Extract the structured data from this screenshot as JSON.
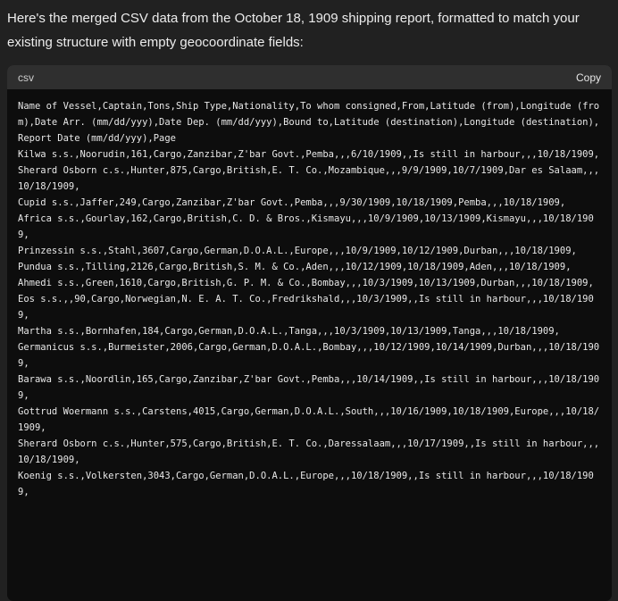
{
  "message": {
    "intro_text": "Here's the merged CSV data from the October 18, 1909 shipping report, formatted to match your existing structure with empty geocoordinate fields:"
  },
  "code_block": {
    "language": "csv",
    "copy_label": "Copy",
    "content": "Name of Vessel,Captain,Tons,Ship Type,Nationality,To whom consigned,From,Latitude (from),Longitude (from),Date Arr. (mm/dd/yyy),Date Dep. (mm/dd/yyy),Bound to,Latitude (destination),Longitude (destination),Report Date (mm/dd/yyy),Page\nKilwa s.s.,Noorudin,161,Cargo,Zanzibar,Z'bar Govt.,Pemba,,,6/10/1909,,Is still in harbour,,,10/18/1909,\nSherard Osborn c.s.,Hunter,875,Cargo,British,E. T. Co.,Mozambique,,,9/9/1909,10/7/1909,Dar es Salaam,,,10/18/1909,\nCupid s.s.,Jaffer,249,Cargo,Zanzibar,Z'bar Govt.,Pemba,,,9/30/1909,10/18/1909,Pemba,,,10/18/1909,\nAfrica s.s.,Gourlay,162,Cargo,British,C. D. & Bros.,Kismayu,,,10/9/1909,10/13/1909,Kismayu,,,10/18/1909,\nPrinzessin s.s.,Stahl,3607,Cargo,German,D.O.A.L.,Europe,,,10/9/1909,10/12/1909,Durban,,,10/18/1909,\nPundua s.s.,Tilling,2126,Cargo,British,S. M. & Co.,Aden,,,10/12/1909,10/18/1909,Aden,,,10/18/1909,\nAhmedi s.s.,Green,1610,Cargo,British,G. P. M. & Co.,Bombay,,,10/3/1909,10/13/1909,Durban,,,10/18/1909,\nEos s.s.,,90,Cargo,Norwegian,N. E. A. T. Co.,Fredrikshald,,,10/3/1909,,Is still in harbour,,,10/18/1909,\nMartha s.s.,Bornhafen,184,Cargo,German,D.O.A.L.,Tanga,,,10/3/1909,10/13/1909,Tanga,,,10/18/1909,\nGermanicus s.s.,Burmeister,2006,Cargo,German,D.O.A.L.,Bombay,,,10/12/1909,10/14/1909,Durban,,,10/18/1909,\nBarawa s.s.,Noordlin,165,Cargo,Zanzibar,Z'bar Govt.,Pemba,,,10/14/1909,,Is still in harbour,,,10/18/1909,\nGottrud Woermann s.s.,Carstens,4015,Cargo,German,D.O.A.L.,South,,,10/16/1909,10/18/1909,Europe,,,10/18/1909,\nSherard Osborn c.s.,Hunter,575,Cargo,British,E. T. Co.,Daressalaam,,,10/17/1909,,Is still in harbour,,,10/18/1909,\nKoenig s.s.,Volkersten,3043,Cargo,German,D.O.A.L.,Europe,,,10/18/1909,,Is still in harbour,,,10/18/1909,"
  }
}
